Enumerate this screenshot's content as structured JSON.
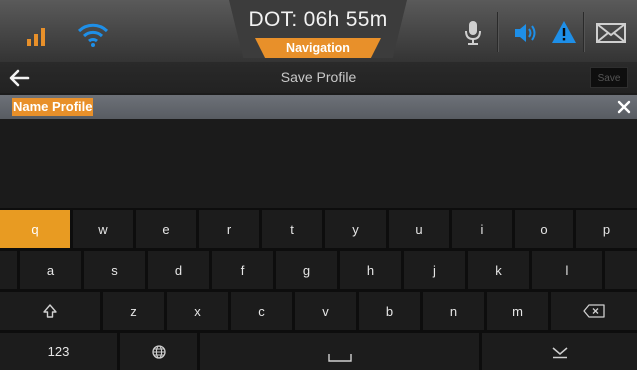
{
  "status_bar": {
    "dot_label": "DOT: 06h 55m",
    "mode_tab": "Navigation",
    "icons": [
      "signal-icon",
      "wifi-icon",
      "microphone-icon",
      "speaker-icon",
      "alert-icon",
      "mail-icon"
    ],
    "colors": {
      "accent": "#e8902a",
      "wifi": "#1e8fe8",
      "alert": "#1e8fe8"
    }
  },
  "title_bar": {
    "title": "Save Profile",
    "save_label": "Save"
  },
  "input": {
    "value": "Name Profile"
  },
  "keyboard": {
    "row1": [
      "q",
      "w",
      "e",
      "r",
      "t",
      "y",
      "u",
      "i",
      "o",
      "p"
    ],
    "row2": [
      "a",
      "s",
      "d",
      "f",
      "g",
      "h",
      "j",
      "k",
      "l"
    ],
    "row3": [
      "z",
      "x",
      "c",
      "v",
      "b",
      "n",
      "m"
    ],
    "numbers_label": "123",
    "active_key": "q"
  }
}
